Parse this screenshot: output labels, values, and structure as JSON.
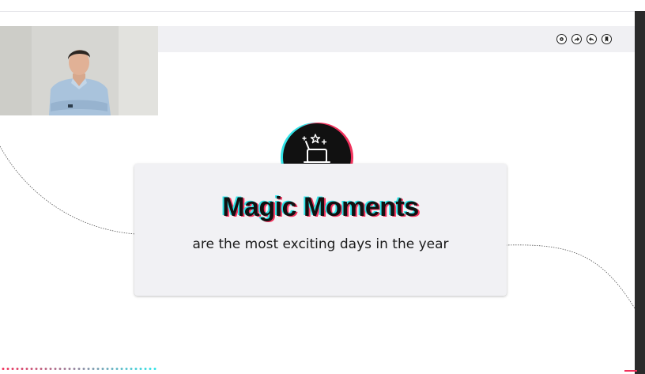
{
  "slide": {
    "title": "Magic Moments",
    "subtitle": "are the most exciting days in the year"
  },
  "toolbar": {
    "buttons": [
      {
        "name": "settings-icon"
      },
      {
        "name": "share-icon"
      },
      {
        "name": "reply-icon"
      },
      {
        "name": "bookmark-icon"
      }
    ]
  },
  "icons": {
    "badge": "magic-hat-icon"
  },
  "colors": {
    "accent_cyan": "#32e4e8",
    "accent_red": "#f0325c",
    "card_bg": "#f1f1f4",
    "badge_bg": "#111111"
  }
}
